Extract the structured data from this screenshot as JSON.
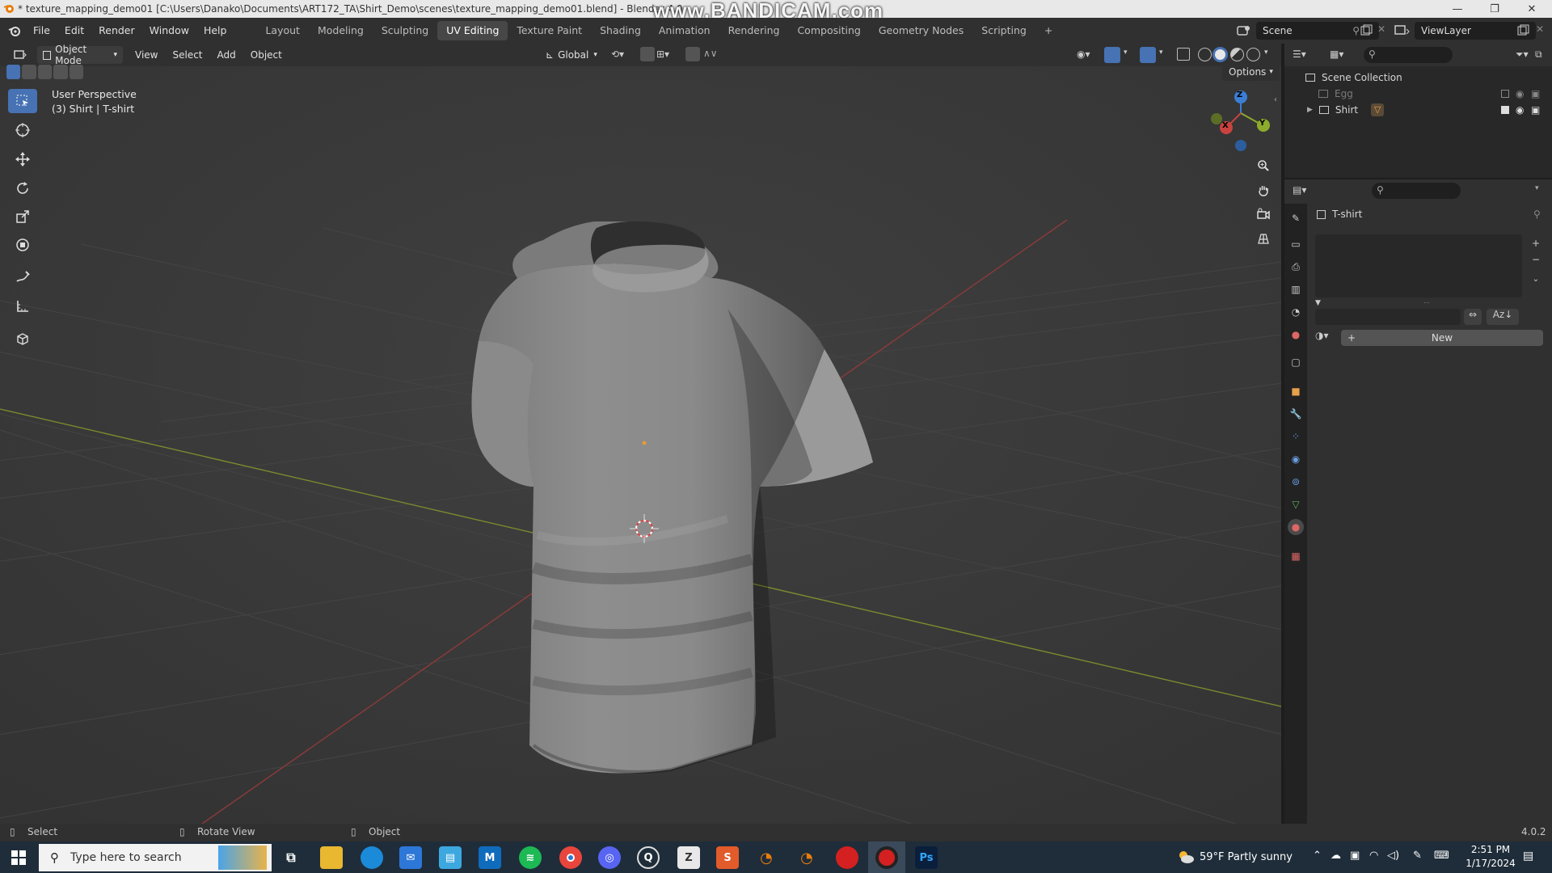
{
  "titlebar": {
    "title": "* texture_mapping_demo01 [C:\\Users\\Danako\\Documents\\ART172_TA\\Shirt_Demo\\scenes\\texture_mapping_demo01.blend] - Blender 4.0",
    "watermark": "www.BANDICAM.com"
  },
  "menu": {
    "items": [
      "File",
      "Edit",
      "Render",
      "Window",
      "Help"
    ],
    "workspaces": [
      "Layout",
      "Modeling",
      "Sculpting",
      "UV Editing",
      "Texture Paint",
      "Shading",
      "Animation",
      "Rendering",
      "Compositing",
      "Geometry Nodes",
      "Scripting"
    ],
    "active_workspace": "UV Editing",
    "scene": "Scene",
    "view_layer": "ViewLayer"
  },
  "viewport_header": {
    "mode": "Object Mode",
    "menus": [
      "View",
      "Select",
      "Add",
      "Object"
    ],
    "transform_orientation": "Global",
    "options": "Options"
  },
  "viewport": {
    "perspective": "User Perspective",
    "object_info": "(3) Shirt | T-shirt",
    "gizmo": {
      "z": "Z",
      "x": "X",
      "y": "Y"
    }
  },
  "outliner": {
    "root": "Scene Collection",
    "items": [
      {
        "name": "Egg"
      },
      {
        "name": "Shirt"
      }
    ]
  },
  "properties": {
    "object_name": "T-shirt",
    "new_button": "New"
  },
  "statusbar": {
    "select": "Select",
    "rotate": "Rotate View",
    "object": "Object",
    "version": "4.0.2"
  },
  "taskbar": {
    "search_placeholder": "Type here to search",
    "weather": "59°F  Partly sunny",
    "time": "2:51 PM",
    "date": "1/17/2024",
    "ps_label": "Ps"
  },
  "colors": {
    "accent": "#4772b3",
    "x_axis": "#c8433f",
    "y_axis": "#8cab2c",
    "z_axis": "#3b7ed6"
  }
}
